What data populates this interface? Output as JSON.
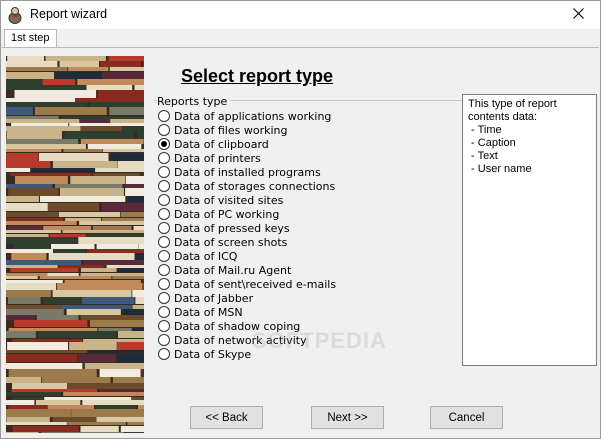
{
  "window": {
    "title": "Report wizard"
  },
  "tabs": [
    {
      "label": "1st step"
    }
  ],
  "heading": "Select report type",
  "reports": {
    "group_label": "Reports type",
    "selected_index": 2,
    "options": [
      "Data of applications working",
      "Data of files working",
      "Data of clipboard",
      "Data of printers",
      "Data of installed programs",
      "Data of storages connections",
      "Data of visited sites",
      "Data of PC working",
      "Data of pressed keys",
      "Data of screen shots",
      "Data of ICQ",
      "Data of Mail.ru Agent",
      "Data of sent\\received e-mails",
      "Data of Jabber",
      "Data of MSN",
      "Data of shadow coping",
      "Data of network activity",
      "Data of Skype"
    ]
  },
  "description": {
    "lines": [
      "This type of report",
      "contents data:",
      " - Time",
      " - Caption",
      " - Text",
      " - User name"
    ]
  },
  "watermark": "SOFTPEDIA",
  "buttons": {
    "back": "<< Back",
    "next": "Next >>",
    "cancel": "Cancel"
  },
  "colors": {
    "window_bg": "#f0f0f0",
    "title_bg": "#ffffff",
    "button_bg": "#e1e1e1"
  },
  "icons": {
    "app": "app-icon",
    "close": "close-icon"
  }
}
